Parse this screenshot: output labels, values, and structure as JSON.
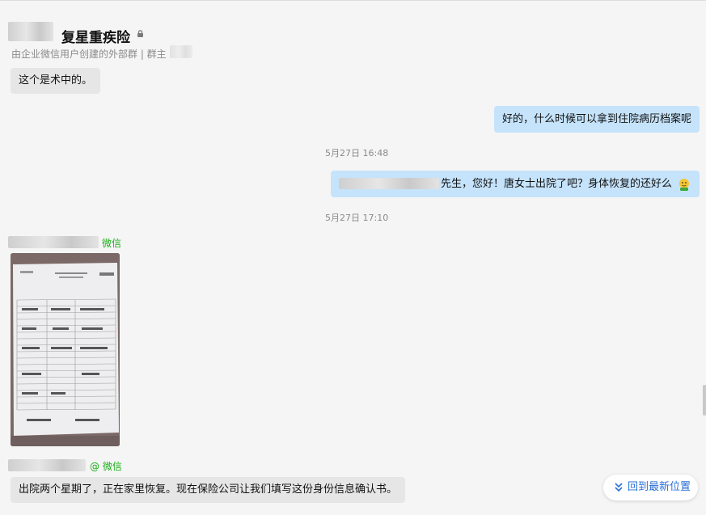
{
  "header": {
    "group_name": "复星重疾险",
    "subtitle": "由企业微信用户创建的外部群 | 群主"
  },
  "messages": {
    "m1": "这个是术中的。",
    "m2": "好的，什么时候可以拿到住院病历档案呢",
    "t1": "5月27日 16:48",
    "m3": "先生，您好！唐女士出院了吧？身体恢复的还好么",
    "t2": "5月27日 17:10",
    "sender_tag_1": "微信",
    "sender_tag_2": "@ 微信",
    "m4": "出院两个星期了，正在家里恢复。现在保险公司让我们填写这份身份信息确认书。"
  },
  "jump_latest": "回到最新位置",
  "icons": {
    "lock": "lock-icon",
    "emoji": "emoji-icon",
    "chevron": "double-chevron-down-icon"
  },
  "colors": {
    "bubble_self": "#c5e3fb",
    "bubble_other": "#e6e6e6",
    "wechat_green": "#1aad19",
    "link_blue": "#2a6fd6"
  }
}
